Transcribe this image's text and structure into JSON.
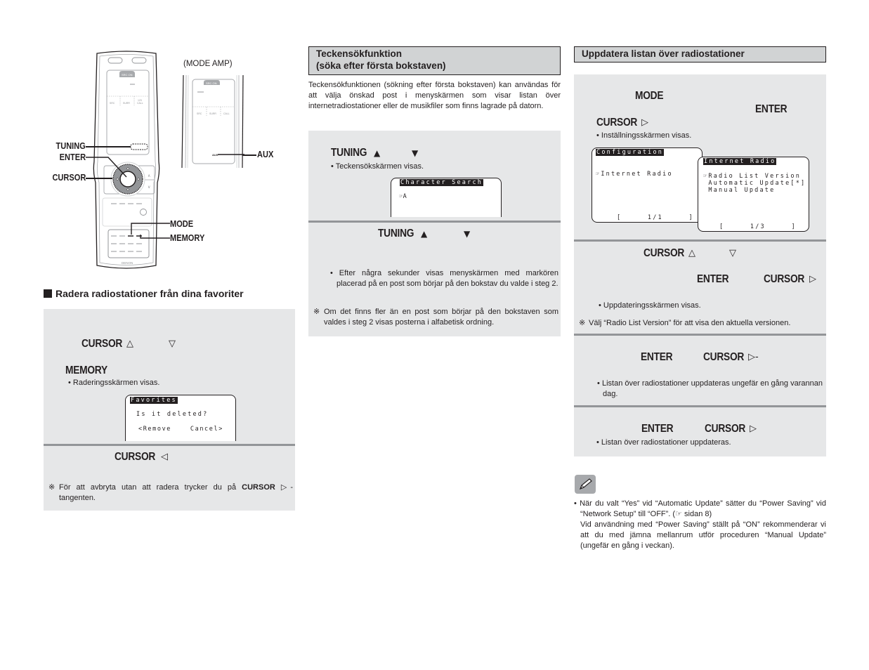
{
  "remote_figure": {
    "labels": {
      "tuning": "TUNING",
      "enter": "ENTER",
      "cursor": "CURSOR",
      "mode": "MODE",
      "memory": "MEMORY",
      "aux": "AUX"
    },
    "inset_caption": "(MODE AMP)",
    "brand": "DENON",
    "lcd_tab": "SRC ON",
    "lcd_cells": [
      "SRC",
      "SURR",
      "CALL"
    ],
    "lcd_cell_extra": "123",
    "inset_aux_mark": "AUX",
    "side_keys": [
      "∧",
      "∨"
    ]
  },
  "favorites_delete": {
    "heading": "Radera radiostationer från dina favoriter",
    "step1": {
      "key": "CURSOR",
      "up": "△",
      "down": "▽"
    },
    "step2": {
      "key": "MEMORY",
      "bullet": "• Raderingsskärmen visas."
    },
    "screen": {
      "title": "Favorites",
      "line1": "Is it deleted?",
      "line2": "<Remove    Cancel>"
    },
    "step3": {
      "key": "CURSOR",
      "arrow": "◁"
    },
    "note_mark": "※",
    "note_prefix": "För att avbryta utan att radera trycker du på",
    "note_key": "CURSOR",
    "note_arrow": "▷-",
    "note_suffix": "tangenten."
  },
  "character_search": {
    "heading_line1": "Teckensökfunktion",
    "heading_line2": "(söka efter första bokstaven)",
    "intro": "Teckensökfunktionen (sökning efter första bokstaven) kan användas för att välja önskad post i menyskärmen som visar listan över internetradiostationer eller de musikfiler som finns lagrade på datorn.",
    "step1": {
      "key": "TUNING",
      "up": "▲",
      "down": "▼",
      "bullet": "• Teckensökskärmen visas."
    },
    "screen": {
      "title": "Character Search",
      "line1": "☞A"
    },
    "step2": {
      "key": "TUNING",
      "up": "▲",
      "down": "▼",
      "bullet": "• Efter några sekunder visas menyskärmen med markören placerad på en post som börjar på den bokstav du valde i steg 2."
    },
    "note_mark": "※",
    "note": "Om det finns fler än en post som börjar på den bokstaven som valdes i steg 2 visas posterna i alfabetisk ordning."
  },
  "update_list": {
    "heading": "Uppdatera listan över radiostationer",
    "step1": {
      "key_mode": "MODE",
      "key_enter": "ENTER",
      "key_cursor": "CURSOR",
      "arrow": "▷",
      "bullet": "• Inställningsskärmen visas."
    },
    "screen_config": {
      "title": "Configuration",
      "line1": "☞Internet Radio",
      "page": "[     1/1     ]"
    },
    "screen_internet": {
      "title": "Internet Radio",
      "line1": "☞Radio List Version",
      "line2": " Automatic Update[*]",
      "line3": " Manual Update",
      "page": "[     1/3     ]"
    },
    "step2": {
      "key_cursor": "CURSOR",
      "up": "△",
      "down": "▽",
      "key_enter": "ENTER",
      "key_cursor2": "CURSOR",
      "arrow": "▷",
      "bullet": "• Uppdateringsskärmen visas.",
      "note_mark": "※",
      "note": "Välj “Radio List Version” för att visa den aktuella versionen."
    },
    "step3": {
      "key_enter": "ENTER",
      "key_cursor": "CURSOR",
      "arrow": "▷-",
      "bullet": "• Listan över radiostationer uppdateras ungefär en gång varannan dag."
    },
    "step4": {
      "key_enter": "ENTER",
      "key_cursor": "CURSOR",
      "arrow": "▷",
      "bullet": "• Listan över radiostationer uppdateras."
    },
    "memo": {
      "icon": "pencil-icon",
      "line1": "• När du valt “Yes” vid “Automatic Update” sätter du “Power Saving” vid “Network Setup” till “OFF”. (",
      "ref_icon": "☞",
      "ref": " sidan 8)",
      "para2": "Vid användning med “Power Saving” ställt på “ON” rekommenderar vi att du med jämna mellanrum utför proceduren “Manual Update” (ungefär en gång i veckan)."
    }
  },
  "colors": {
    "panel_bg": "#e6e7e8",
    "separator": "#939598",
    "heading_bg": "#d1d3d4",
    "text": "#231f20"
  }
}
